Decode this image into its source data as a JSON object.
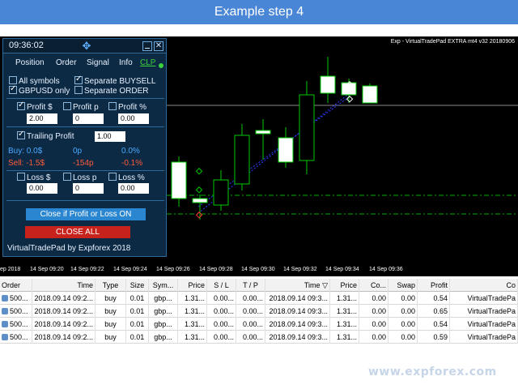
{
  "banner": {
    "title": "Example step 4"
  },
  "chart": {
    "window_title": "Exp - VirtualTradePad EXTRA mt4 v32 20180906",
    "x_ticks": [
      "ep 2018",
      "14 Sep 09:20",
      "14 Sep 09:22",
      "14 Sep 09:24",
      "14 Sep 09:26",
      "14 Sep 09:28",
      "14 Sep 09:30",
      "14 Sep 09:32",
      "14 Sep 09:34",
      "14 Sep 09:36"
    ],
    "colors": {
      "background": "#000000",
      "bull": "#00c800",
      "bear": "#ffffff",
      "grid_line": "#00b000",
      "trend": "#2a3cff"
    }
  },
  "pad": {
    "clock": "09:36:02",
    "tabs": [
      "Position",
      "Order",
      "Signal",
      "Info",
      "CLP"
    ],
    "active_tab": "CLP",
    "options": {
      "all_symbols": "All symbols",
      "separate_buysell": "Separate BUYSELL",
      "gbpusd_only": "GBPUSD only",
      "separate_order": "Separate ORDER"
    },
    "profit": {
      "labels": [
        "Profit $",
        "Profit p",
        "Profit %"
      ],
      "values": [
        "2.00",
        "0",
        "0.00"
      ]
    },
    "trailing": {
      "label": "Trailing Profit",
      "value": "1.00"
    },
    "buy": {
      "label": "Buy: 0.0$",
      "points": "0p",
      "percent": "0.0%"
    },
    "sell": {
      "label": "Sell: -1.5$",
      "points": "-154p",
      "percent": "-0.1%"
    },
    "loss": {
      "labels": [
        "Loss $",
        "Loss p",
        "Loss %"
      ],
      "values": [
        "0.00",
        "0",
        "0.00"
      ]
    },
    "btn_close_profit": "Close if Profit or Loss ON",
    "btn_close_all": "CLOSE ALL",
    "footer": "VirtualTradePad by Expforex 2018"
  },
  "table": {
    "headers": [
      "Order",
      "Time",
      "Type",
      "Size",
      "Sym...",
      "Price",
      "S / L",
      "T / P",
      "Time",
      "Price",
      "Co...",
      "Swap",
      "Profit",
      "Co"
    ],
    "sort_indicator": "▽",
    "rows": [
      [
        "500...",
        "2018.09.14 09:2...",
        "buy",
        "0.01",
        "gbp...",
        "1.31...",
        "0.00...",
        "0.00...",
        "2018.09.14 09:3...",
        "1.31...",
        "0.00",
        "0.00",
        "0.54",
        "VirtualTradePa"
      ],
      [
        "500...",
        "2018.09.14 09:2...",
        "buy",
        "0.01",
        "gbp...",
        "1.31...",
        "0.00...",
        "0.00...",
        "2018.09.14 09:3...",
        "1.31...",
        "0.00",
        "0.00",
        "0.65",
        "VirtualTradePa"
      ],
      [
        "500...",
        "2018.09.14 09:2...",
        "buy",
        "0.01",
        "gbp...",
        "1.31...",
        "0.00...",
        "0.00...",
        "2018.09.14 09:3...",
        "1.31...",
        "0.00",
        "0.00",
        "0.54",
        "VirtualTradePa"
      ],
      [
        "500...",
        "2018.09.14 09:2...",
        "buy",
        "0.01",
        "gbp...",
        "1.31...",
        "0.00...",
        "0.00...",
        "2018.09.14 09:3...",
        "1.31...",
        "0.00",
        "0.00",
        "0.59",
        "VirtualTradePa"
      ]
    ]
  },
  "watermark": "www.expforex.com"
}
